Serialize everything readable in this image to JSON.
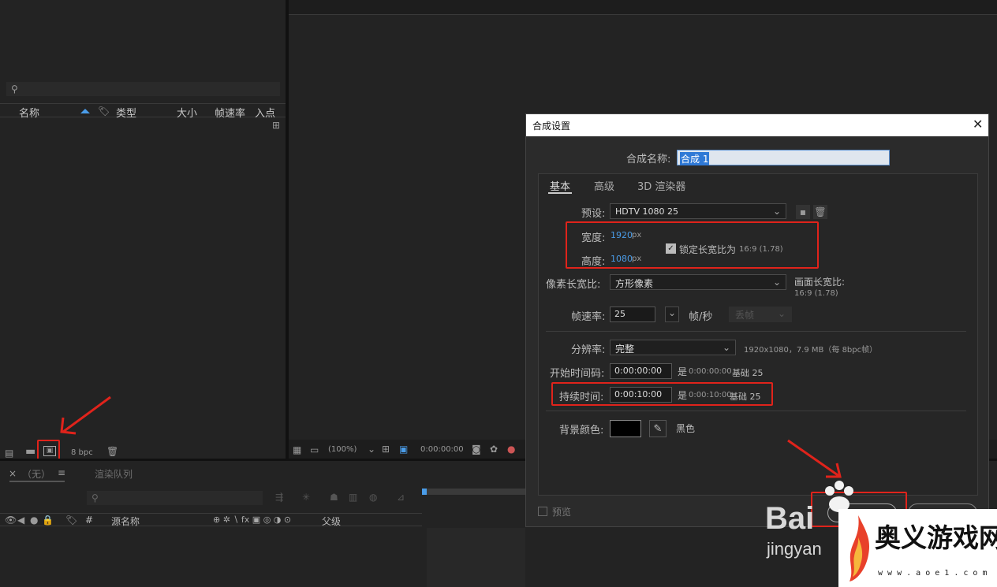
{
  "project_panel": {
    "search_placeholder": "",
    "columns": [
      "名称",
      "类型",
      "大小",
      "帧速率",
      "入点"
    ],
    "footer_bpc": "8 bpc"
  },
  "timeline_panel": {
    "tab_none": "（无）",
    "tab_render_queue": "渲染队列",
    "columns": {
      "hash": "#",
      "source_name": "源名称",
      "parent": "父级"
    }
  },
  "viewer_footer": {
    "zoom": "(100%)",
    "timecode": "0:00:00:00"
  },
  "dialog": {
    "title": "合成设置",
    "comp_name_label": "合成名称:",
    "comp_name_value": "合成 1",
    "tabs": [
      "基本",
      "高级",
      "3D 渲染器"
    ],
    "preset_label": "预设:",
    "preset_value": "HDTV 1080 25",
    "width_label": "宽度:",
    "width_value": "1920",
    "height_label": "高度:",
    "height_value": "1080",
    "unit_px": "px",
    "lock_ratio_label": "锁定长宽比为",
    "lock_ratio_value": "16:9 (1.78)",
    "pixel_aspect_label": "像素长宽比:",
    "pixel_aspect_value": "方形像素",
    "frame_aspect_label": "画面长宽比:",
    "frame_aspect_value": "16:9 (1.78)",
    "frame_rate_label": "帧速率:",
    "frame_rate_value": "25",
    "fps_unit": "帧/秒",
    "drop_frame": "丢帧",
    "resolution_label": "分辨率:",
    "resolution_value": "完整",
    "resolution_info": "1920x1080，7.9 MB（每 8bpc帧）",
    "start_tc_label": "开始时间码:",
    "start_tc_value": "0:00:00:00",
    "start_tc_is": "是",
    "start_tc_note": "0:00:00:00",
    "start_tc_base": "基础 25",
    "duration_label": "持续时间:",
    "duration_value": "0:00:10:00",
    "duration_is": "是",
    "duration_note": "0:00:10:00",
    "duration_base": "基础 25",
    "bg_color_label": "背景颜色:",
    "bg_color_name": "黑色",
    "bg_color_hex": "#000000",
    "preview_label": "预览"
  },
  "watermark": {
    "baidu": "Bai",
    "baidu_sub": "jingyan",
    "site_name": "奥义游戏网",
    "site_url": "w w w . a o e 1 . c o m"
  },
  "colors": {
    "accent_red": "#e0231b",
    "link_blue": "#4a9ce8"
  }
}
